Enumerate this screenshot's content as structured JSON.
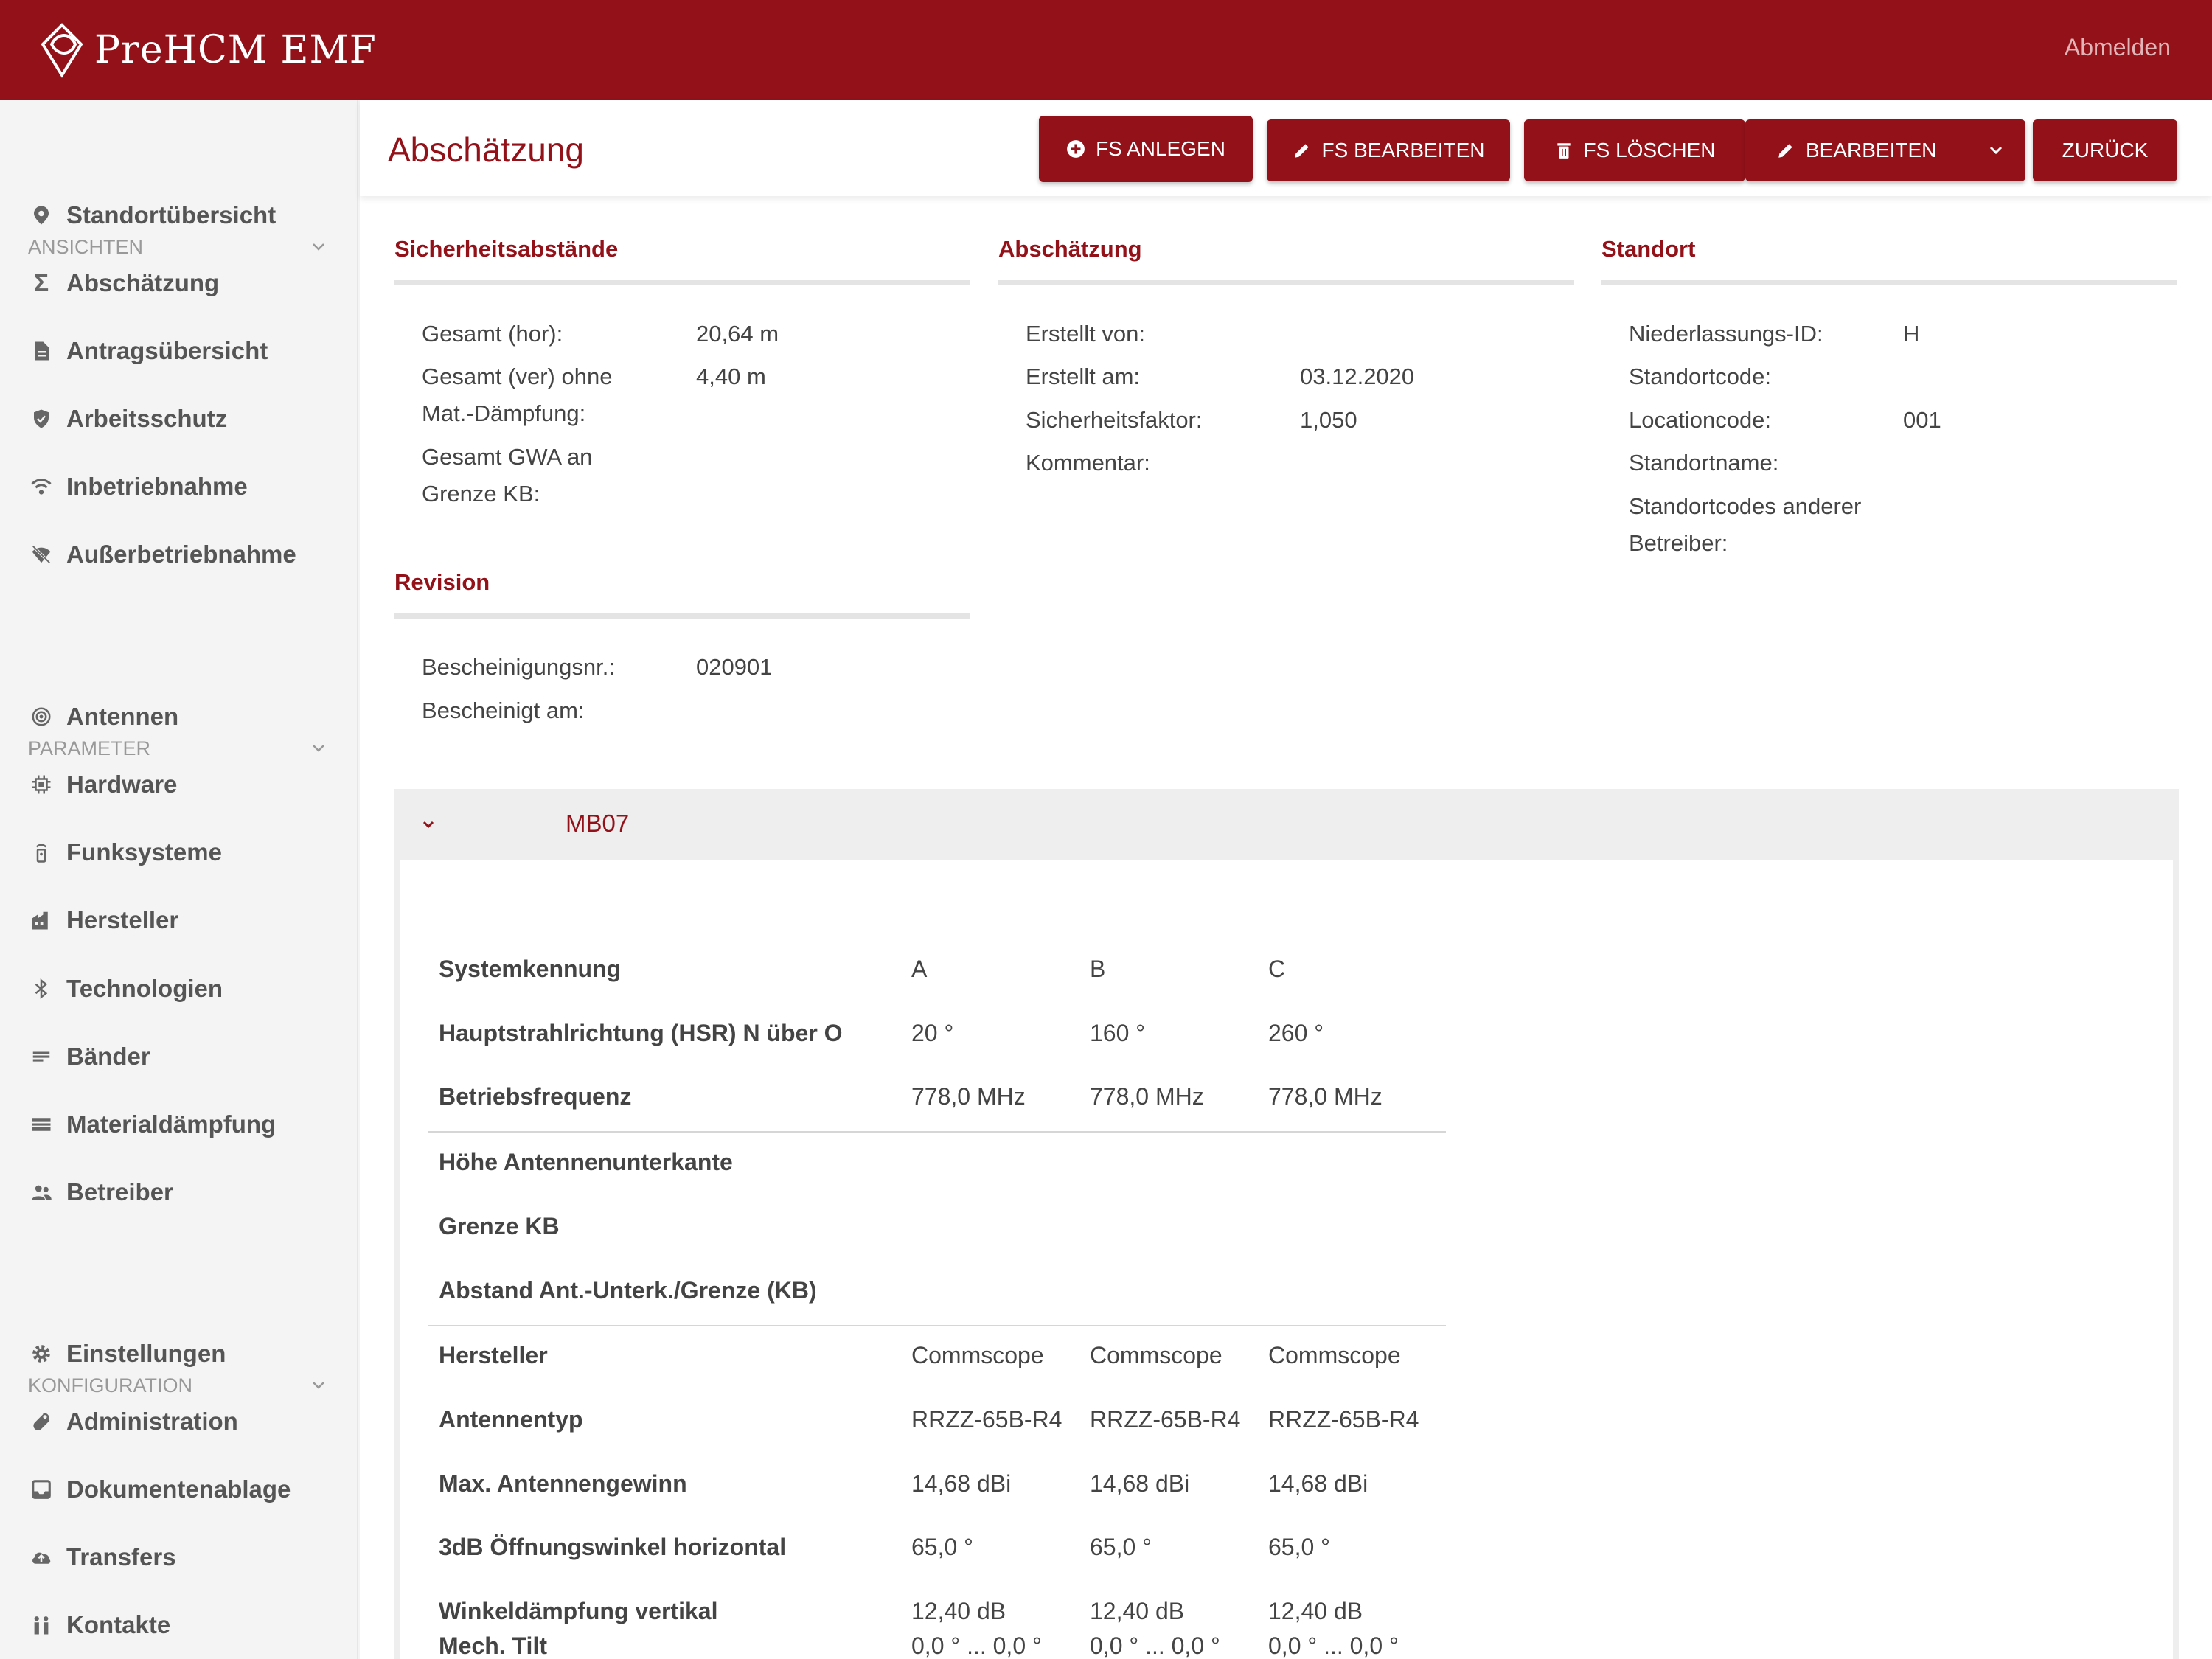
{
  "app": {
    "brand": "PreHCM  EMF",
    "logout_label": "Abmelden"
  },
  "sidebar": {
    "sections": [
      {
        "label": "ANSICHTEN"
      },
      {
        "label": "PARAMETER"
      },
      {
        "label": "KONFIGURATION"
      }
    ],
    "items": [
      {
        "label": "Standortübersicht",
        "icon": "map-pin-icon"
      },
      {
        "label": "Abschätzung",
        "icon": "sigma-icon"
      },
      {
        "label": "Antragsübersicht",
        "icon": "document-icon"
      },
      {
        "label": "Arbeitsschutz",
        "icon": "shield-icon"
      },
      {
        "label": "Inbetriebnahme",
        "icon": "wifi-icon"
      },
      {
        "label": "Außerbetriebnahme",
        "icon": "wifi-off-icon"
      },
      {
        "label": "Antennen",
        "icon": "antenna-icon"
      },
      {
        "label": "Hardware",
        "icon": "chip-icon"
      },
      {
        "label": "Funksysteme",
        "icon": "radio-icon"
      },
      {
        "label": "Hersteller",
        "icon": "factory-icon"
      },
      {
        "label": "Technologien",
        "icon": "bluetooth-icon"
      },
      {
        "label": "Bänder",
        "icon": "lines-icon"
      },
      {
        "label": "Materialdämpfung",
        "icon": "wall-icon"
      },
      {
        "label": "Betreiber",
        "icon": "people-icon"
      },
      {
        "label": "Einstellungen",
        "icon": "gear-icon"
      },
      {
        "label": "Administration",
        "icon": "wrench-icon"
      },
      {
        "label": "Dokumentenablage",
        "icon": "inbox-icon"
      },
      {
        "label": "Transfers",
        "icon": "cloud-upload-icon"
      },
      {
        "label": "Kontakte",
        "icon": "contacts-icon"
      }
    ]
  },
  "page": {
    "title": "Abschätzung",
    "buttons": {
      "fs_anlegen": "FS ANLEGEN",
      "fs_bearbeiten": "FS BEARBEITEN",
      "fs_loeschen": "FS LÖSCHEN",
      "bearbeiten": "BEARBEITEN",
      "zurueck": "ZURÜCK"
    }
  },
  "sicherheitsabstaende": {
    "heading": "Sicherheitsabstände",
    "rows": [
      {
        "label": "Gesamt (hor):",
        "value": "20,64 m"
      },
      {
        "label_line1": "Gesamt (ver) ohne",
        "label_line2": "Mat.-Dämpfung:",
        "value": "4,40 m"
      },
      {
        "label_line1": "Gesamt GWA an",
        "label_line2": "Grenze KB:",
        "value": ""
      }
    ]
  },
  "abschaetzung": {
    "heading": "Abschätzung",
    "rows": [
      {
        "label": "Erstellt von:",
        "value": ""
      },
      {
        "label": "Erstellt am:",
        "value": "03.12.2020"
      },
      {
        "label": "Sicherheitsfaktor:",
        "value": "1,050"
      },
      {
        "label": "Kommentar:",
        "value": ""
      }
    ]
  },
  "standort": {
    "heading": "Standort",
    "rows": [
      {
        "label": "Niederlassungs-ID:",
        "value": "H"
      },
      {
        "label": "Standortcode:",
        "value": ""
      },
      {
        "label": "Locationcode:",
        "value": "001"
      },
      {
        "label": "Standortname:",
        "value": ""
      },
      {
        "label_line1": "Standortcodes anderer",
        "label_line2": "Betreiber:",
        "value": ""
      }
    ]
  },
  "revision": {
    "heading": "Revision",
    "rows": [
      {
        "label": "Bescheinigungsnr.:",
        "value": "020901"
      },
      {
        "label": "Bescheinigt am:",
        "value": ""
      }
    ]
  },
  "panel": {
    "title": "MB07",
    "rows": [
      {
        "label": "Systemkennung",
        "values": [
          "A",
          "B",
          "C"
        ]
      },
      {
        "label": "Hauptstrahlrichtung (HSR) N über O",
        "values": [
          "20 °",
          "160 °",
          "260 °"
        ]
      },
      {
        "label": "Betriebsfrequenz",
        "values": [
          "778,0 MHz",
          "778,0 MHz",
          "778,0 MHz"
        ]
      },
      {
        "label": "Höhe Antennenunterkante",
        "values": [
          "",
          "",
          ""
        ]
      },
      {
        "label": "Grenze KB",
        "values": [
          "",
          "",
          ""
        ]
      },
      {
        "label": "Abstand Ant.-Unterk./Grenze (KB)",
        "values": [
          "",
          "",
          ""
        ]
      },
      {
        "label": "Hersteller",
        "values": [
          "Commscope",
          "Commscope",
          "Commscope"
        ]
      },
      {
        "label": "Antennentyp",
        "values": [
          "RRZZ-65B-R4",
          "RRZZ-65B-R4",
          "RRZZ-65B-R4"
        ]
      },
      {
        "label": "Max. Antennengewinn",
        "values": [
          "14,68 dBi",
          "14,68 dBi",
          "14,68 dBi"
        ]
      },
      {
        "label": "3dB Öffnungswinkel horizontal",
        "values": [
          "65,0 °",
          "65,0 °",
          "65,0 °"
        ]
      },
      {
        "label": "Winkeldämpfung vertikal",
        "values": [
          "12,40 dB",
          "12,40 dB",
          "12,40 dB"
        ]
      },
      {
        "label": "Mech. Tilt",
        "values": [
          "0,0 ° ... 0,0 °",
          "0,0 ° ... 0,0 °",
          "0,0 ° ... 0,0 °"
        ]
      }
    ]
  }
}
